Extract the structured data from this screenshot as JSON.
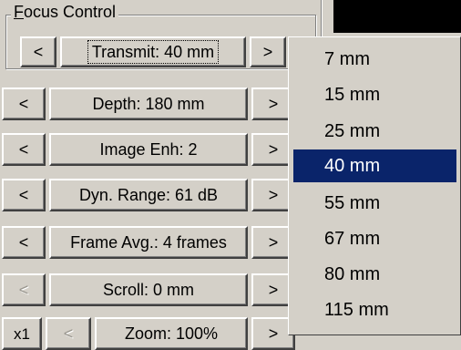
{
  "focus_group": {
    "title": "Focus Control"
  },
  "controls": {
    "transmit": {
      "prev": "<",
      "label": "Transmit: 40 mm",
      "next": ">"
    },
    "depth": {
      "prev": "<",
      "label": "Depth: 180 mm",
      "next": ">"
    },
    "image_enh": {
      "prev": "<",
      "label": "Image Enh: 2",
      "next": ">"
    },
    "dyn_range": {
      "prev": "<",
      "label": "Dyn. Range: 61 dB",
      "next": ">"
    },
    "frame_avg": {
      "prev": "<",
      "label": "Frame Avg.: 4 frames",
      "next": ">"
    },
    "scroll": {
      "prev": "<",
      "label": "Scroll: 0 mm",
      "next": ">"
    },
    "zoom": {
      "x1": "x1",
      "prev": "<",
      "label": "Zoom: 100%",
      "next": ">"
    }
  },
  "transmit_dropdown": {
    "options": [
      "7 mm",
      "15 mm",
      "25 mm",
      "40 mm",
      "55 mm",
      "67 mm",
      "80 mm",
      "115 mm"
    ],
    "selected": "40 mm"
  }
}
